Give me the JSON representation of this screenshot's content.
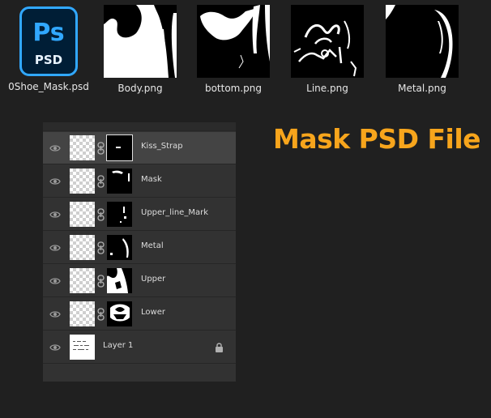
{
  "files": [
    {
      "name": "0Shoe_Mask.psd",
      "icon": "photoshop-file-icon",
      "icon_text": "Ps",
      "icon_sub": "PSD"
    },
    {
      "name": "Body.png",
      "icon": "mask-thumbnail"
    },
    {
      "name": "bottom.png",
      "icon": "mask-thumbnail"
    },
    {
      "name": "Line.png",
      "icon": "mask-thumbnail"
    },
    {
      "name": "Metal.png",
      "icon": "mask-thumbnail"
    }
  ],
  "headline": "Mask PSD File",
  "layers": [
    {
      "name": "Kiss_Strap",
      "selected": true
    },
    {
      "name": "Mask",
      "selected": false
    },
    {
      "name": "Upper_line_Mark",
      "selected": false
    },
    {
      "name": "Metal",
      "selected": false
    },
    {
      "name": "Upper",
      "selected": false
    },
    {
      "name": "Lower",
      "selected": false
    }
  ],
  "background_layer": {
    "name": "Layer 1",
    "locked": true
  },
  "colors": {
    "accent": "#f7a51c",
    "ps_blue": "#31a8ff",
    "ps_dark": "#001e36",
    "panel": "#323232",
    "selected_row": "#444444"
  }
}
